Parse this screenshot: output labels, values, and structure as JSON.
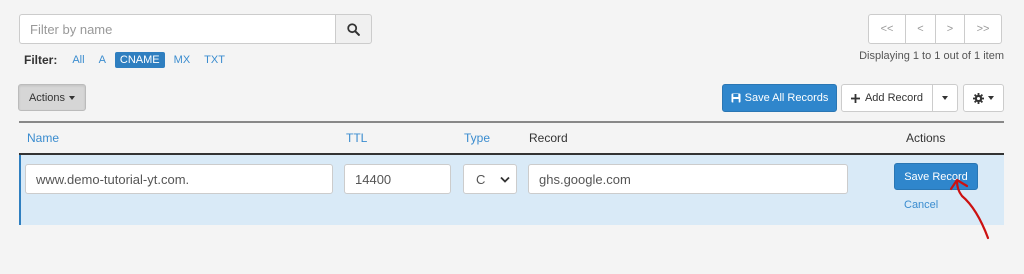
{
  "search": {
    "placeholder": "Filter by name",
    "icon": "search-icon"
  },
  "filter": {
    "label": "Filter:",
    "options": [
      "All",
      "A",
      "CNAME",
      "MX",
      "TXT"
    ],
    "active": "CNAME"
  },
  "pagination": {
    "buttons": [
      "<<",
      "<",
      ">",
      ">>"
    ],
    "status": "Displaying 1 to 1 out of 1 item"
  },
  "toolbar": {
    "actions_label": "Actions",
    "save_all_label": "Save All Records",
    "add_record_label": "Add Record"
  },
  "table": {
    "headers": {
      "name": "Name",
      "ttl": "TTL",
      "type": "Type",
      "record": "Record",
      "actions": "Actions"
    },
    "edit_row": {
      "name": "www.demo-tutorial-yt.com.",
      "ttl": "14400",
      "type": "C",
      "record": "ghs.google.com",
      "save_label": "Save Record",
      "cancel_label": "Cancel"
    }
  },
  "colors": {
    "accent": "#2f86cc",
    "link": "#3a8ccf",
    "row_highlight": "#d9eaf7",
    "annotation": "#cc1111"
  }
}
